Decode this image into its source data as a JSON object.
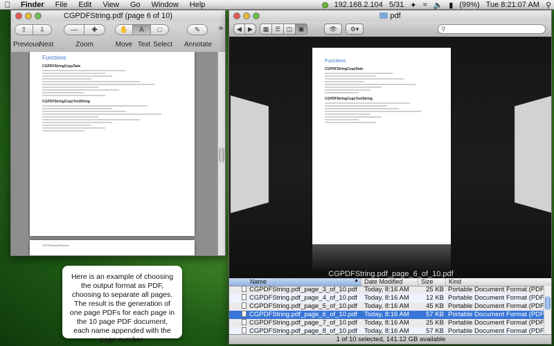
{
  "menubar": {
    "app": "Finder",
    "items": [
      "File",
      "Edit",
      "View",
      "Go",
      "Window",
      "Help"
    ],
    "ip": "192.168.2.104",
    "date": "5/31",
    "battery": "(99%)",
    "clock": "Tue 8:21:07 AM"
  },
  "preview": {
    "title": "CGPDFString.pdf (page 6 of 10)",
    "toolbar": {
      "previous": "Previous",
      "next": "Next",
      "zoom": "Zoom",
      "move": "Move",
      "text": "Text",
      "select": "Select",
      "annotate": "Annotate"
    },
    "page": {
      "section": "Functions",
      "fn1": "CGPDFStringCopyDate",
      "fn2": "CGPDFStringCopyTextString",
      "footer": "CGPDFString Reference"
    }
  },
  "finder": {
    "title": "pdf",
    "search_placeholder": "",
    "coverflow_caption": "CGPDFString.pdf_page_6_of_10.pdf",
    "columns": [
      "Name",
      "Date Modified",
      "Size",
      "Kind"
    ],
    "files": [
      {
        "name": "CGPDFString.pdf_page_3_of_10.pdf",
        "date": "Today, 8:16 AM",
        "size": "25 KB",
        "kind": "Portable Document Format (PDF)"
      },
      {
        "name": "CGPDFString.pdf_page_4_of_10.pdf",
        "date": "Today, 8:16 AM",
        "size": "12 KB",
        "kind": "Portable Document Format (PDF)"
      },
      {
        "name": "CGPDFString.pdf_page_5_of_10.pdf",
        "date": "Today, 8:16 AM",
        "size": "45 KB",
        "kind": "Portable Document Format (PDF)"
      },
      {
        "name": "CGPDFString.pdf_page_6_of_10.pdf",
        "date": "Today, 8:16 AM",
        "size": "57 KB",
        "kind": "Portable Document Format (PDF)"
      },
      {
        "name": "CGPDFString.pdf_page_7_of_10.pdf",
        "date": "Today, 8:16 AM",
        "size": "25 KB",
        "kind": "Portable Document Format (PDF)"
      },
      {
        "name": "CGPDFString.pdf_page_8_of_10.pdf",
        "date": "Today, 8:16 AM",
        "size": "57 KB",
        "kind": "Portable Document Format (PDF)"
      }
    ],
    "status": "1 of 10 selected, 141.12 GB available"
  },
  "note": "Here is an example of choosing the output format as PDF, choosing to separate all pages. The result is the generation of one page PDFs for each page in the 10 page PDF document, each name appended with the page number."
}
